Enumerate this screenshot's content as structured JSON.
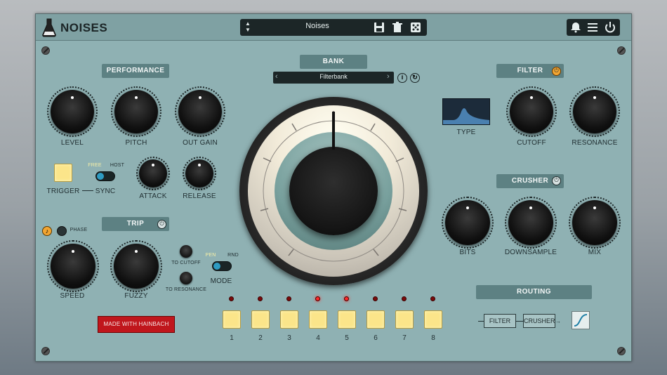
{
  "app": {
    "title": "NOISES"
  },
  "preset": {
    "name": "Noises"
  },
  "sections": {
    "performance": "PERFORMANCE",
    "bank": "BANK",
    "filter": "FILTER",
    "crusher": "CRUSHER",
    "trip": "TRIP",
    "routing": "ROUTING"
  },
  "bank": {
    "selected": "Filterbank"
  },
  "performance": {
    "level": "LEVEL",
    "pitch": "PITCH",
    "out_gain": "OUT GAIN",
    "trigger": "TRIGGER",
    "sync": "SYNC",
    "free": "FREE",
    "host": "HOST",
    "attack": "ATTACK",
    "release": "RELEASE"
  },
  "filter": {
    "type": "TYPE",
    "cutoff": "CUTOFF",
    "resonance": "RESONANCE"
  },
  "crusher": {
    "bits": "BITS",
    "downsample": "DOWNSAMPLE",
    "mix": "MIX"
  },
  "trip": {
    "phase": "PHASE",
    "speed": "SPEED",
    "fuzzy": "FUZZY",
    "to_cutoff": "TO CUTOFF",
    "to_resonance": "TO RESONANCE",
    "pen": "PEN",
    "rnd": "RND",
    "mode": "MODE"
  },
  "made_with": "MADE WITH HAINBACH",
  "pads": {
    "labels": [
      "1",
      "2",
      "3",
      "4",
      "5",
      "6",
      "7",
      "8"
    ],
    "leds_on": [
      false,
      false,
      false,
      true,
      true,
      false,
      false,
      false
    ]
  },
  "routing": {
    "filter": "FILTER",
    "crusher": "CRUSHER"
  },
  "colors": {
    "accent": "#f2a532",
    "panel": "#8fb1b3",
    "section": "#5d8183",
    "pad": "#fbe58a",
    "badge": "#c0161c"
  }
}
